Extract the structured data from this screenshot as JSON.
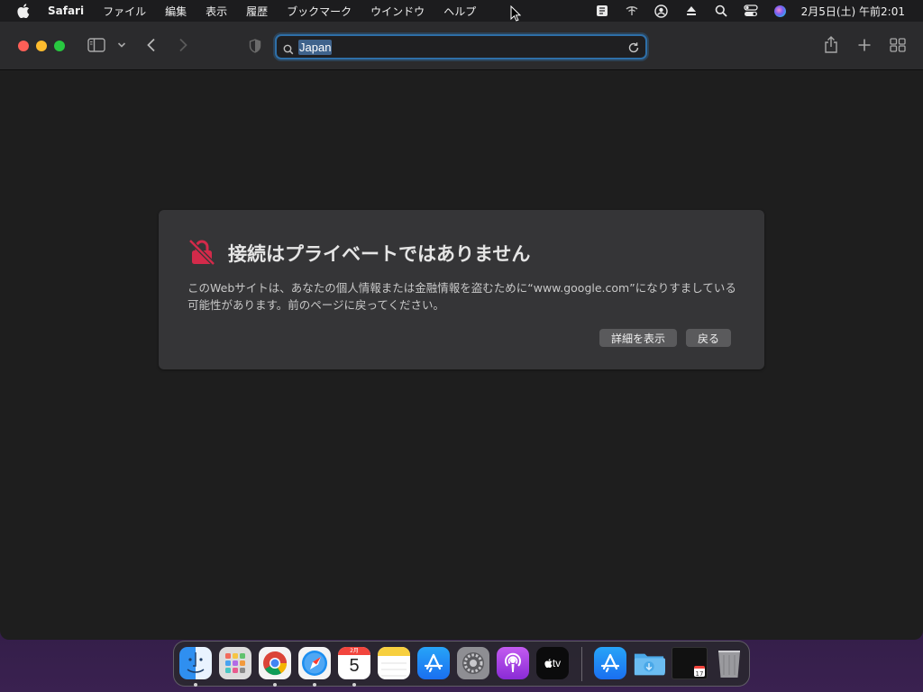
{
  "menubar": {
    "app_name": "Safari",
    "items": [
      "ファイル",
      "編集",
      "表示",
      "履歴",
      "ブックマーク",
      "ウインドウ",
      "ヘルプ"
    ],
    "clock": "2月5日(土) 午前2:01"
  },
  "address_bar": {
    "value": "Japan"
  },
  "error_page": {
    "title": "接続はプライベートではありません",
    "description": "このWebサイトは、あなたの個人情報または金融情報を盗むために“www.google.com”になりすましている可能性があります。前のページに戻ってください。",
    "details_button": "詳細を表示",
    "back_button": "戻る"
  },
  "dock": {
    "calendar_month": "2月",
    "calendar_day": "5",
    "tv_label": "tv",
    "recent_calendar_day": "17"
  },
  "colors": {
    "accent": "#2e6fa8",
    "error_icon": "#d32a4a",
    "close": "#fe5f57",
    "minimize": "#febc2e",
    "maximize": "#28c840"
  }
}
